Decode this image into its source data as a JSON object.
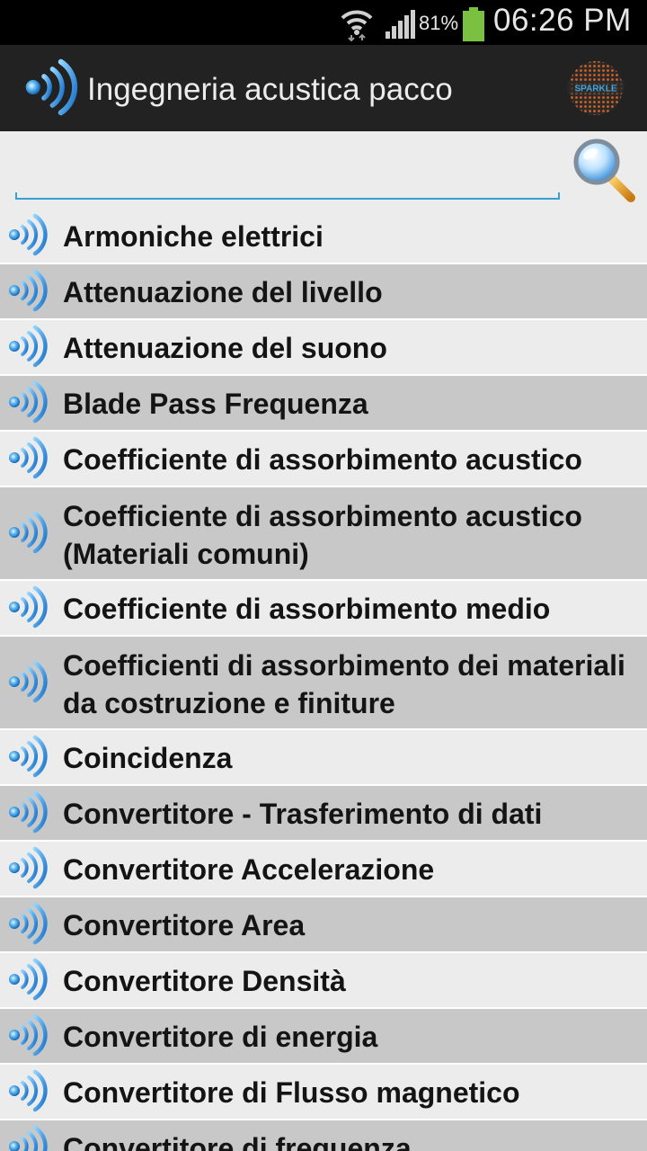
{
  "status_bar": {
    "battery_percent": "81%",
    "time": "06:26 PM",
    "icons": [
      "wifi-icon",
      "cell-signal-icon",
      "battery-icon"
    ],
    "battery_color": "#7ac142"
  },
  "action_bar": {
    "title": "Ingegneria acustica pacco",
    "app_icon": "sound-wave-icon",
    "logo_text": "SPARKLE"
  },
  "search": {
    "value": "",
    "placeholder": "",
    "button_icon": "magnifier-icon",
    "accent_color": "#33a0d8"
  },
  "list": {
    "item_icon": "sound-wave-icon",
    "items": [
      {
        "label": "Armoniche elettrici",
        "lines": 1
      },
      {
        "label": "Attenuazione del livello",
        "lines": 1
      },
      {
        "label": "Attenuazione del suono",
        "lines": 1
      },
      {
        "label": "Blade Pass Frequenza",
        "lines": 1
      },
      {
        "label": "Coefficiente di assorbimento acustico",
        "lines": 1
      },
      {
        "label": "Coefficiente di assorbimento acustico (Materiali comuni)",
        "lines": 2
      },
      {
        "label": "Coefficiente di assorbimento medio",
        "lines": 1
      },
      {
        "label": "Coefficienti di assorbimento dei materiali da costruzione e finiture",
        "lines": 2
      },
      {
        "label": "Coincidenza",
        "lines": 1
      },
      {
        "label": "Convertitore - Trasferimento di dati",
        "lines": 1
      },
      {
        "label": "Convertitore Accelerazione",
        "lines": 1
      },
      {
        "label": "Convertitore Area",
        "lines": 1
      },
      {
        "label": "Convertitore Densità",
        "lines": 1
      },
      {
        "label": "Convertitore di energia",
        "lines": 1
      },
      {
        "label": "Convertitore di Flusso magnetico",
        "lines": 1
      },
      {
        "label": "Convertitore di frequenza",
        "lines": 1
      }
    ]
  }
}
